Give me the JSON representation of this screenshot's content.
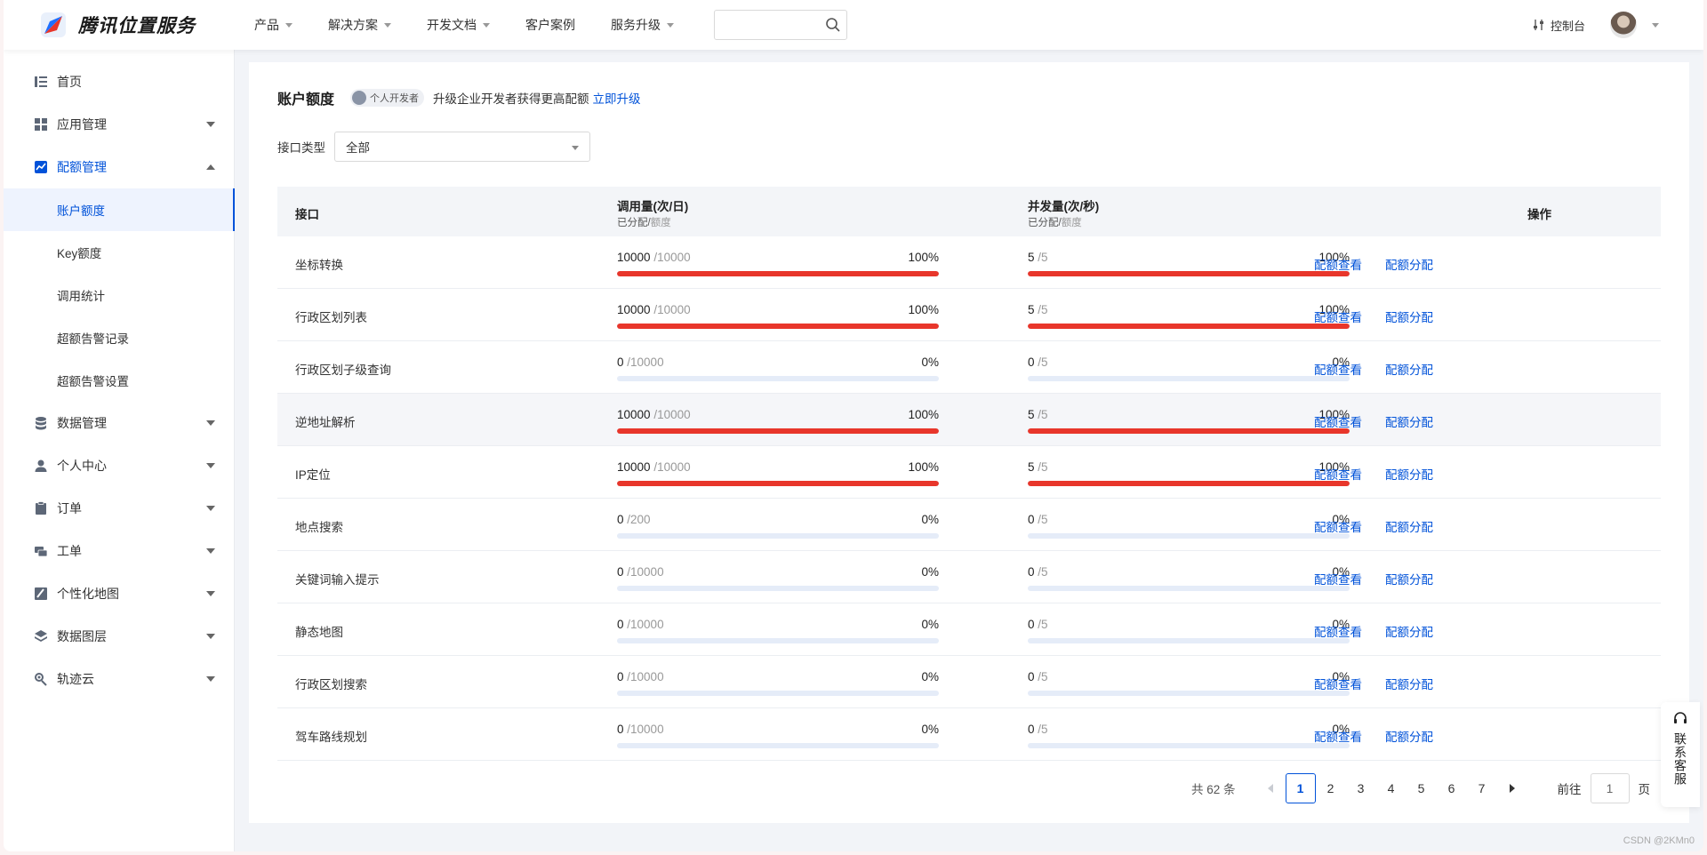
{
  "header": {
    "logo_text": "腾讯位置服务",
    "nav": [
      {
        "label": "产品",
        "dropdown": true
      },
      {
        "label": "解决方案",
        "dropdown": true
      },
      {
        "label": "开发文档",
        "dropdown": true
      },
      {
        "label": "客户案例",
        "dropdown": false
      },
      {
        "label": "服务升级",
        "dropdown": true
      }
    ],
    "search": {
      "value": "",
      "placeholder": ""
    },
    "console_label": "控制台"
  },
  "sidebar": {
    "items": [
      {
        "label": "首页",
        "icon": "list-icon"
      },
      {
        "label": "应用管理",
        "icon": "grid-icon"
      },
      {
        "label": "配额管理",
        "icon": "chart-icon"
      },
      {
        "label": "数据管理",
        "icon": "database-icon"
      },
      {
        "label": "个人中心",
        "icon": "user-icon"
      },
      {
        "label": "订单",
        "icon": "clipboard-icon"
      },
      {
        "label": "工单",
        "icon": "ticket-icon"
      },
      {
        "label": "个性化地图",
        "icon": "map-style-icon"
      },
      {
        "label": "数据图层",
        "icon": "layers-icon"
      },
      {
        "label": "轨迹云",
        "icon": "track-icon"
      }
    ],
    "quota_sub": [
      "账户额度",
      "Key额度",
      "调用统计",
      "超额告警记录",
      "超额告警设置"
    ]
  },
  "main": {
    "title": "账户额度",
    "badge": "个人开发者",
    "upgrade_text": "升级企业开发者获得更高配额",
    "upgrade_link": "立即升级",
    "filter_label": "接口类型",
    "filter_value": "全部",
    "table": {
      "headers": {
        "api": "接口",
        "calls": "调用量(次/日)",
        "concurrency": "并发量(次/秒)",
        "sub_allocated": "已分配",
        "sub_quota": "额度",
        "ops": "操作"
      },
      "op_view": "配额查看",
      "op_allocate": "配额分配",
      "rows": [
        {
          "name": "坐标转换",
          "call_used": "10000",
          "call_quota": "/10000",
          "call_pct": "100%",
          "call_ratio": 1,
          "conc_used": "5",
          "conc_quota": "/5",
          "conc_pct": "100%",
          "conc_ratio": 1
        },
        {
          "name": "行政区划列表",
          "call_used": "10000",
          "call_quota": "/10000",
          "call_pct": "100%",
          "call_ratio": 1,
          "conc_used": "5",
          "conc_quota": "/5",
          "conc_pct": "100%",
          "conc_ratio": 1
        },
        {
          "name": "行政区划子级查询",
          "call_used": "0",
          "call_quota": "/10000",
          "call_pct": "0%",
          "call_ratio": 0,
          "conc_used": "0",
          "conc_quota": "/5",
          "conc_pct": "0%",
          "conc_ratio": 0
        },
        {
          "name": "逆地址解析",
          "call_used": "10000",
          "call_quota": "/10000",
          "call_pct": "100%",
          "call_ratio": 1,
          "conc_used": "5",
          "conc_quota": "/5",
          "conc_pct": "100%",
          "conc_ratio": 1
        },
        {
          "name": "IP定位",
          "call_used": "10000",
          "call_quota": "/10000",
          "call_pct": "100%",
          "call_ratio": 1,
          "conc_used": "5",
          "conc_quota": "/5",
          "conc_pct": "100%",
          "conc_ratio": 1
        },
        {
          "name": "地点搜索",
          "call_used": "0",
          "call_quota": "/200",
          "call_pct": "0%",
          "call_ratio": 0,
          "conc_used": "0",
          "conc_quota": "/5",
          "conc_pct": "0%",
          "conc_ratio": 0
        },
        {
          "name": "关键词输入提示",
          "call_used": "0",
          "call_quota": "/10000",
          "call_pct": "0%",
          "call_ratio": 0,
          "conc_used": "0",
          "conc_quota": "/5",
          "conc_pct": "0%",
          "conc_ratio": 0
        },
        {
          "name": "静态地图",
          "call_used": "0",
          "call_quota": "/10000",
          "call_pct": "0%",
          "call_ratio": 0,
          "conc_used": "0",
          "conc_quota": "/5",
          "conc_pct": "0%",
          "conc_ratio": 0
        },
        {
          "name": "行政区划搜索",
          "call_used": "0",
          "call_quota": "/10000",
          "call_pct": "0%",
          "call_ratio": 0,
          "conc_used": "0",
          "conc_quota": "/5",
          "conc_pct": "0%",
          "conc_ratio": 0
        },
        {
          "name": "驾车路线规划",
          "call_used": "0",
          "call_quota": "/10000",
          "call_pct": "0%",
          "call_ratio": 0,
          "conc_used": "0",
          "conc_quota": "/5",
          "conc_pct": "0%",
          "conc_ratio": 0
        }
      ]
    },
    "pagination": {
      "total": "共 62 条",
      "pages": [
        "1",
        "2",
        "3",
        "4",
        "5",
        "6",
        "7"
      ],
      "current": "1",
      "goto_label": "前往",
      "goto_value": "1",
      "goto_unit": "页"
    }
  },
  "float_service": "联系客服",
  "watermark": "CSDN @2KMn0",
  "colors": {
    "accent": "#0052d9",
    "progress_full": "#e8362b",
    "progress_track": "#e5ecf8"
  }
}
